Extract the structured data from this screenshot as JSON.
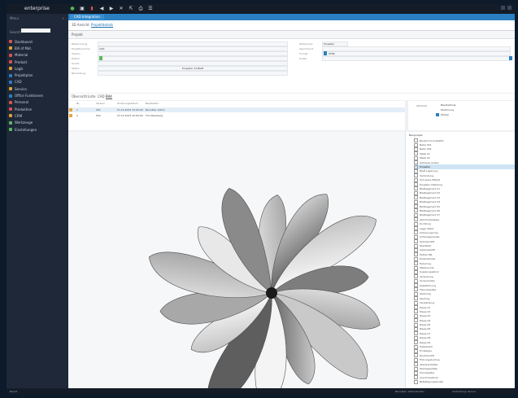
{
  "app": {
    "brand": "enterprise"
  },
  "sidebar": {
    "header": "Menu",
    "search_label": "Search",
    "items": [
      {
        "label": "Dashboard",
        "color": "#d9534f"
      },
      {
        "label": "Bill of Mat.",
        "color": "#e0a030"
      },
      {
        "label": "Material",
        "color": "#d9534f"
      },
      {
        "label": "Produkt",
        "color": "#d9534f"
      },
      {
        "label": "Logik",
        "color": "#e0a030"
      },
      {
        "label": "Projektplan",
        "color": "#2a7fc1"
      },
      {
        "label": "CAD",
        "color": "#2a7fc1"
      },
      {
        "label": "Service",
        "color": "#e0a030"
      },
      {
        "label": "Office Funktionen",
        "color": "#2a7fc1"
      },
      {
        "label": "Personal",
        "color": "#d9534f"
      },
      {
        "label": "Produktion",
        "color": "#d9534f"
      },
      {
        "label": "CRM",
        "color": "#e0a030"
      },
      {
        "label": "Werkzeuge",
        "color": "#5cb85c"
      },
      {
        "label": "Einstellungen",
        "color": "#5cb85c"
      }
    ]
  },
  "main": {
    "tab": "CAD Integration",
    "subtabs": [
      "3D Ansicht",
      "Projektdetails"
    ],
    "toolstrip": "Projekt",
    "form": {
      "left_labels": [
        "Bezeichnung",
        "Projektnummer",
        "Version",
        "Datum",
        "Kunde",
        "Status",
        "Bemerkung"
      ],
      "left_values": [
        "",
        "CAD",
        "",
        "",
        "",
        "",
        "Propeller 14 Blatt"
      ],
      "right_labels": [
        "Dateiname",
        "Speicherort",
        "Format",
        "Größe"
      ],
      "right_values": [
        "Propeller",
        "",
        "STEP",
        ""
      ]
    },
    "view_tabs": [
      "Übersicht",
      "Liste",
      "CAD",
      "Bild"
    ],
    "table": {
      "headers": [
        "Nr.",
        "Version",
        "Änderungsdatum",
        "Bearbeiter"
      ],
      "rows": [
        [
          "1",
          "001",
          "07.12.2023 10:00:00",
          "Benutzer Admin"
        ],
        [
          "2",
          "002",
          "07.12.2023 10:00:00",
          "Tim Steinberg"
        ]
      ]
    },
    "right_panel": {
      "label": "Attribute",
      "items": [
        "Bearbeitung",
        "Zeichnung",
        "Modell"
      ]
    },
    "tree": {
      "root": "Baugruppe",
      "items": [
        "Bauteil Grundplatte",
        "Nabe 001",
        "Nabe 002",
        "Welle 01",
        "Welle 02",
        "Gehäuse Außen",
        "Propeller",
        "Blatt Lagerung",
        "Verbindung",
        "Schraube M6x20",
        "Propeller Haltering",
        "Blattsegment 01",
        "Blattsegment 02",
        "Blattsegment 03",
        "Blattsegment 04",
        "Blattsegment 05",
        "Blattsegment 06",
        "Blattsegment 07",
        "Abschlusskappe",
        "Dichtring",
        "Lager 6204",
        "Sicherungsring",
        "Unterlegscheibe",
        "Zylinderstift",
        "Passfeder",
        "Gewindestift",
        "Mutter M6",
        "Distanzhülse",
        "Federring",
        "Wellenende",
        "Kupplungsstück",
        "Abdeckung",
        "Sensorhalter",
        "Kabelführung",
        "Flanschplatte",
        "Stützring",
        "Stellring",
        "Verstärkung",
        "Rippe 01",
        "Rippe 02",
        "Rippe 03",
        "Rippe 04",
        "Rippe 05",
        "Rippe 06",
        "Rippe 07",
        "Rippe 08",
        "Rippe 09",
        "Halteblech",
        "Endkappe",
        "Zentrierstift",
        "Führungsbuchse",
        "Abstandshalter",
        "Montageplatte",
        "Schutzgitter",
        "Anschlussstück",
        "Befestigungswinkel"
      ],
      "selected_index": 6
    },
    "status": {
      "left": "Bereit",
      "right": "Benutzer: Administrator",
      "right2": "Verbindung: Server"
    }
  }
}
